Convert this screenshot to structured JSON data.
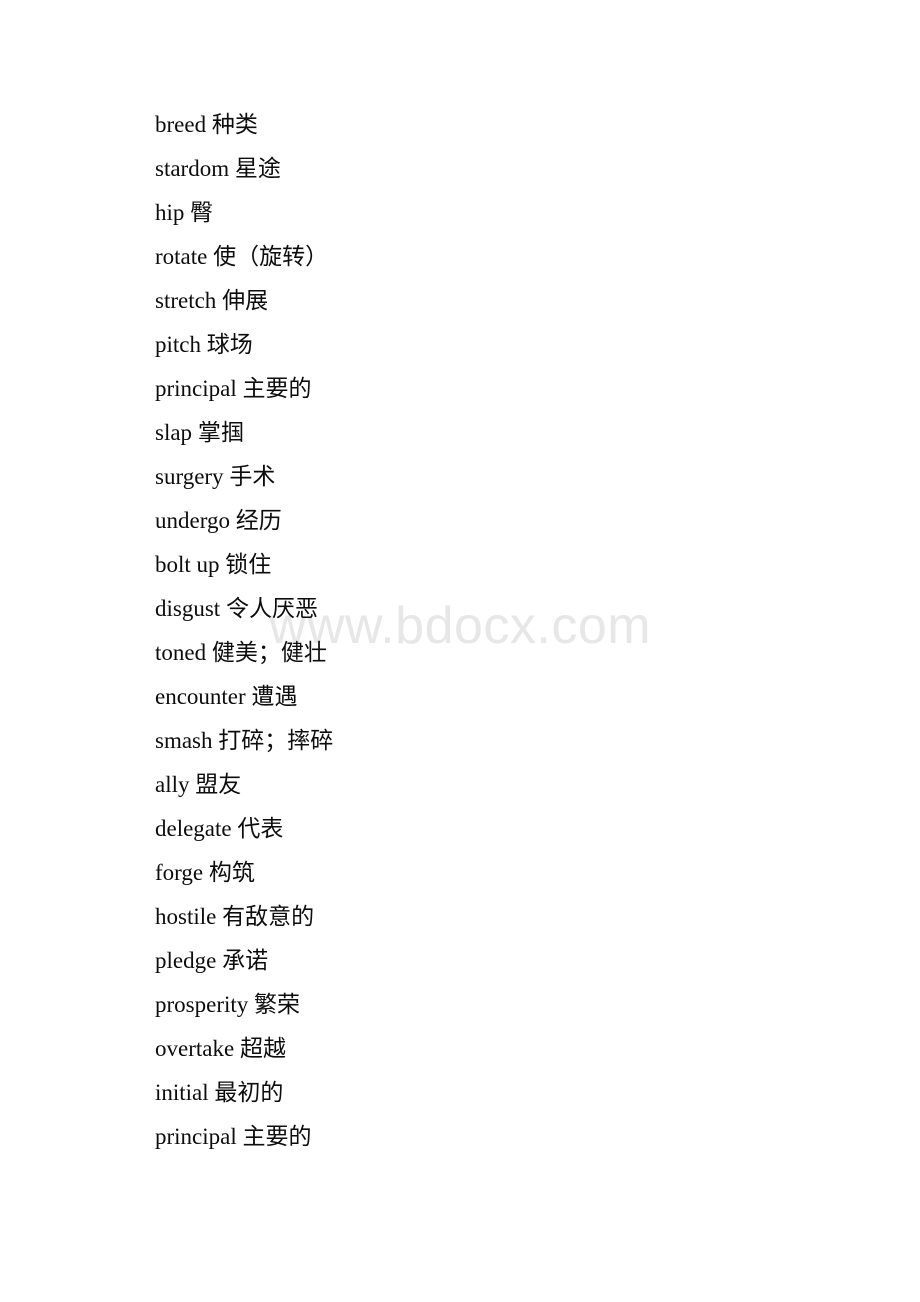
{
  "document": {
    "background_color": "#ffffff",
    "text_color": "#0d0d0d"
  },
  "watermark": {
    "text": "www.bdocx.com",
    "color": "#e7e7e7"
  },
  "vocab_list": [
    {
      "term": "breed",
      "gloss": "种类"
    },
    {
      "term": "stardom",
      "gloss": "星途"
    },
    {
      "term": "hip",
      "gloss": "臀"
    },
    {
      "term": "rotate",
      "gloss": "使（旋转）"
    },
    {
      "term": "stretch",
      "gloss": "伸展"
    },
    {
      "term": "pitch",
      "gloss": "球场"
    },
    {
      "term": "principal",
      "gloss": "主要的"
    },
    {
      "term": "slap",
      "gloss": "掌掴"
    },
    {
      "term": "surgery",
      "gloss": "手术"
    },
    {
      "term": "undergo",
      "gloss": "经历"
    },
    {
      "term": "bolt up",
      "gloss": "锁住"
    },
    {
      "term": "disgust",
      "gloss": "令人厌恶"
    },
    {
      "term": "toned",
      "gloss": "健美；健壮"
    },
    {
      "term": "encounter",
      "gloss": "遭遇"
    },
    {
      "term": "smash",
      "gloss": "打碎；摔碎"
    },
    {
      "term": "ally",
      "gloss": "盟友"
    },
    {
      "term": "delegate",
      "gloss": "代表"
    },
    {
      "term": "forge",
      "gloss": "构筑"
    },
    {
      "term": "hostile",
      "gloss": "有敌意的"
    },
    {
      "term": "pledge",
      "gloss": "承诺"
    },
    {
      "term": "prosperity",
      "gloss": "繁荣"
    },
    {
      "term": "overtake",
      "gloss": "超越"
    },
    {
      "term": "initial",
      "gloss": "最初的"
    },
    {
      "term": "principal",
      "gloss": "主要的"
    }
  ]
}
